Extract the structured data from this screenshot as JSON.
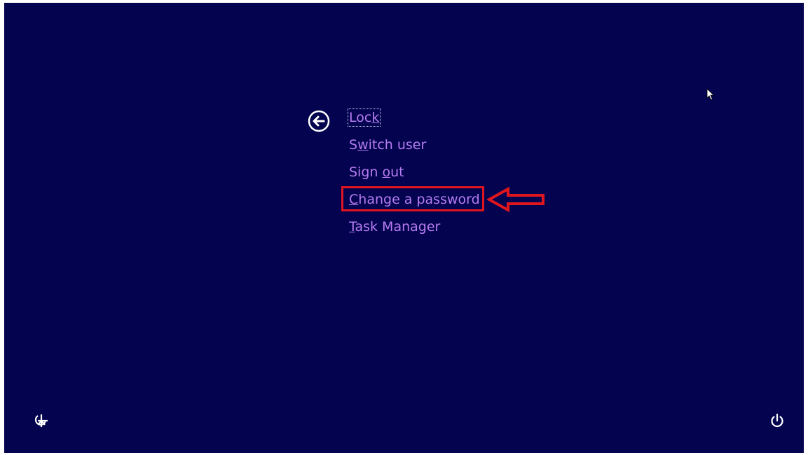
{
  "menu": {
    "items": [
      {
        "id": "lock",
        "before": "Loc",
        "underline": "k",
        "after": ""
      },
      {
        "id": "switch-user",
        "before": "S",
        "underline": "w",
        "after": "itch user"
      },
      {
        "id": "sign-out",
        "before": "Sign ",
        "underline": "o",
        "after": "ut"
      },
      {
        "id": "change-password",
        "before": "",
        "underline": "C",
        "after": "hange a password"
      },
      {
        "id": "task-manager",
        "before": "",
        "underline": "T",
        "after": "ask Manager"
      }
    ],
    "focused_item": "lock",
    "highlighted_item": "change-password"
  },
  "icons": {
    "back": "back-arrow-icon",
    "ease_of_access": "ease-of-access-icon",
    "power": "power-icon",
    "cursor": "mouse-cursor-icon"
  },
  "colors": {
    "background": "#03034f",
    "menu_text": "#b67cf2",
    "annotation_red": "#e0161e"
  }
}
